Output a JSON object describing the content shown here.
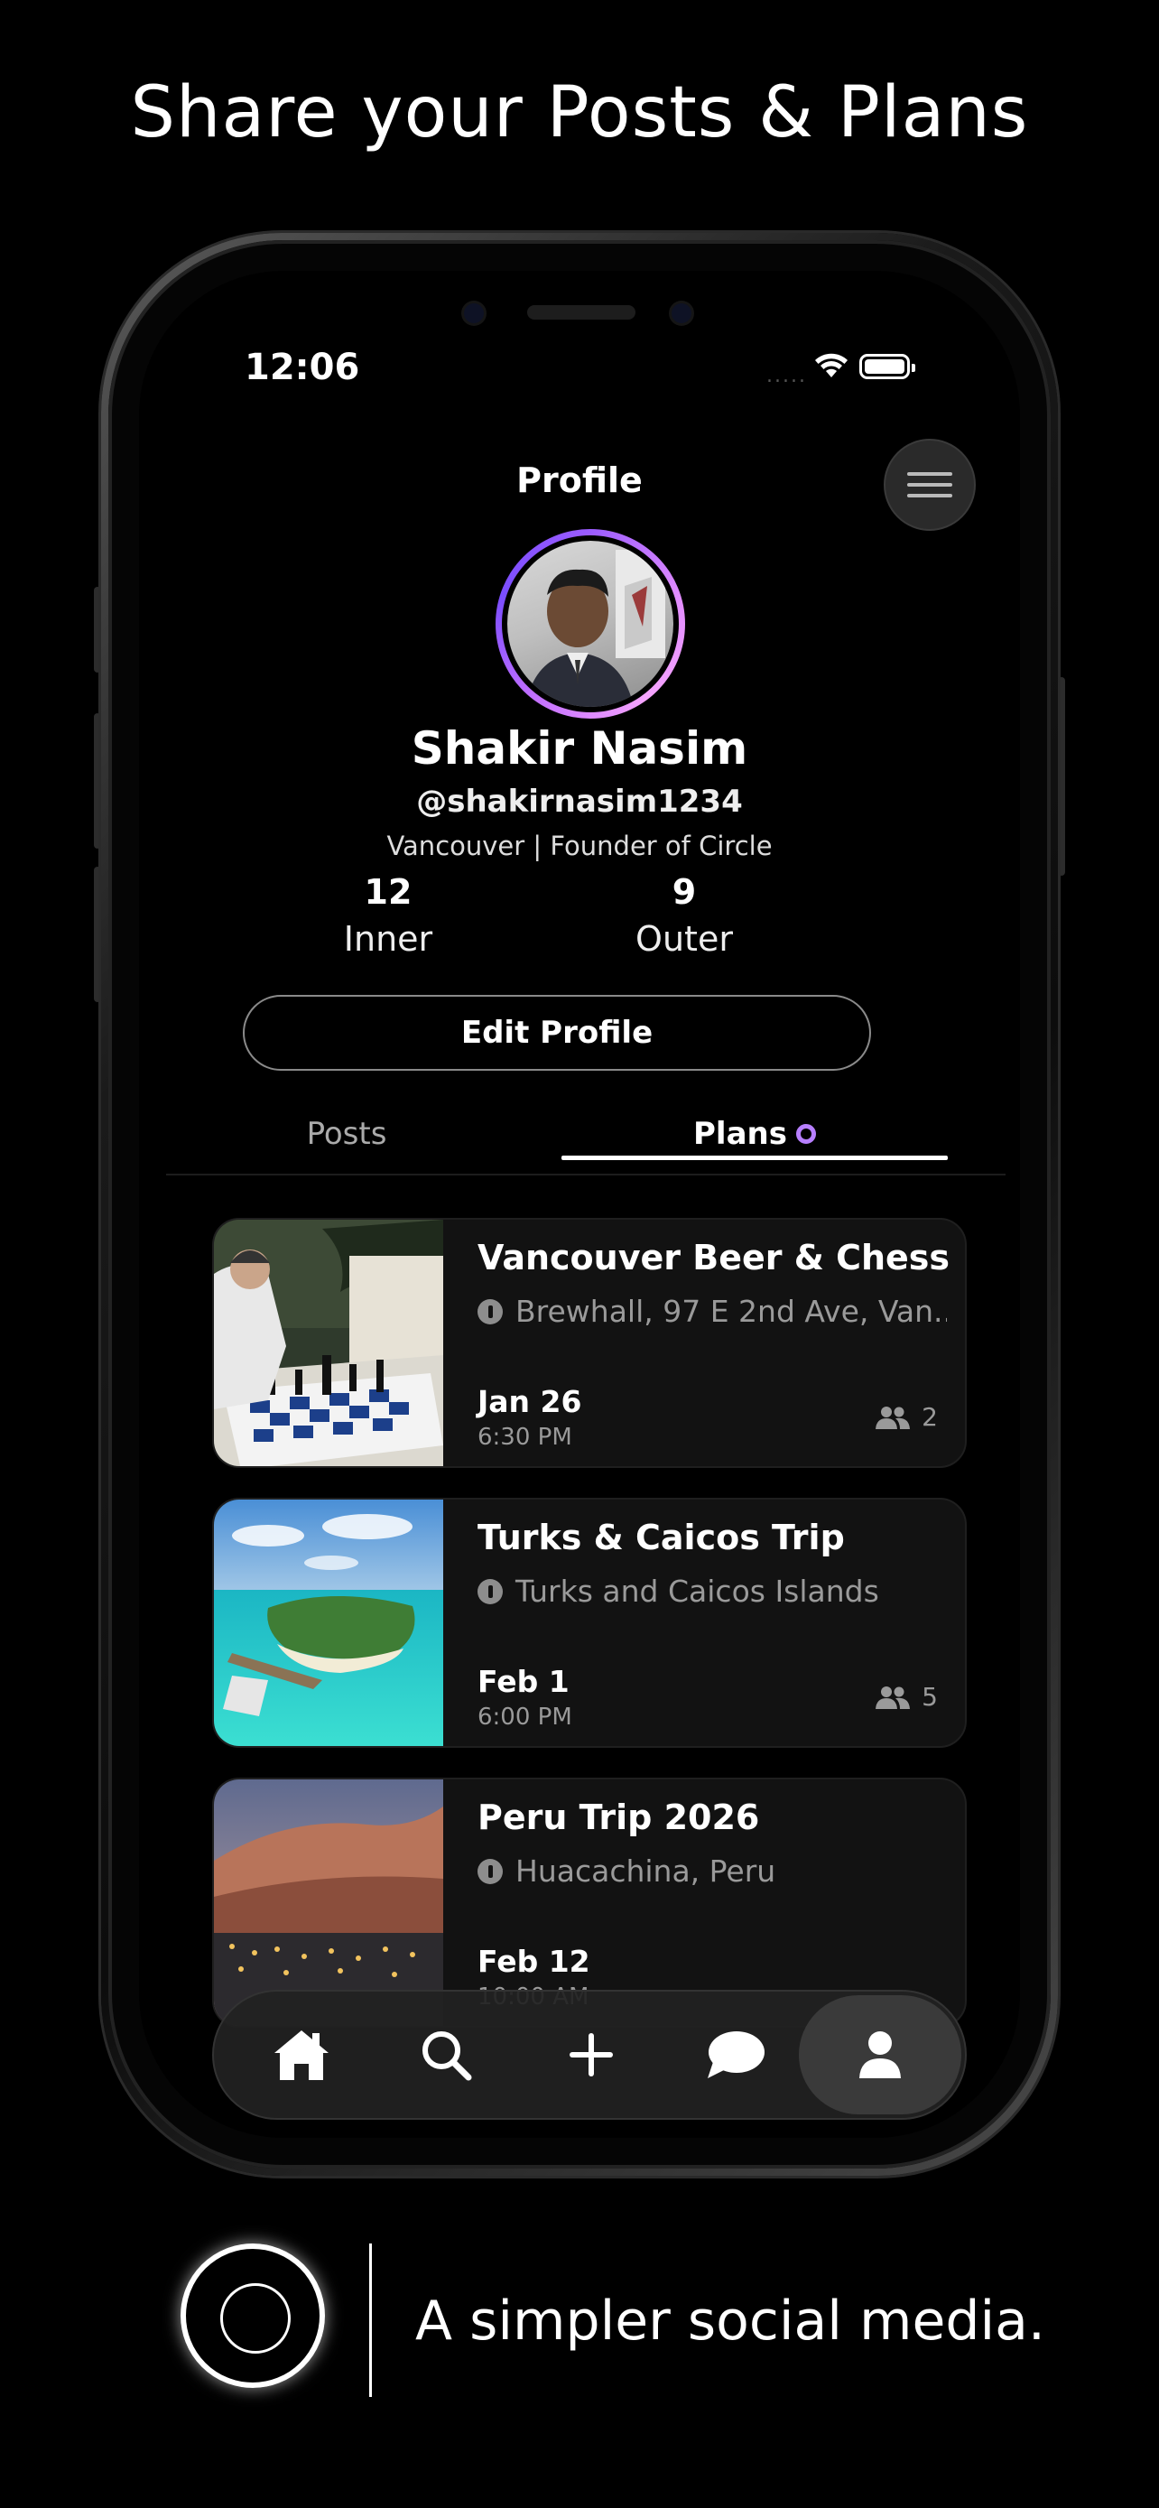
{
  "headline": "Share your Posts & Plans",
  "status": {
    "time": "12:06",
    "dots": "....."
  },
  "header": {
    "title": "Profile"
  },
  "profile": {
    "name": "Shakir Nasim",
    "handle": "@shakirnasim1234",
    "bio": "Vancouver | Founder of Circle",
    "stats": [
      {
        "value": "12",
        "label": "Inner"
      },
      {
        "value": "9",
        "label": "Outer"
      }
    ],
    "edit_label": "Edit Profile"
  },
  "tabs": [
    {
      "label": "Posts",
      "active": false
    },
    {
      "label": "Plans",
      "active": true
    }
  ],
  "plans": [
    {
      "title": "Vancouver Beer & Chess",
      "location": "Brewhall, 97 E 2nd Ave, Van...",
      "date": "Jan 26",
      "time": "6:30 PM",
      "attendees": "2"
    },
    {
      "title": "Turks & Caicos Trip",
      "location": "Turks and Caicos Islands",
      "date": "Feb 1",
      "time": "6:00 PM",
      "attendees": "5"
    },
    {
      "title": "Peru Trip 2026",
      "location": "Huacachina, Peru",
      "date": "Feb 12",
      "time": "10:00 AM",
      "attendees": ""
    }
  ],
  "tabbar": {
    "items": [
      {
        "icon": "home-icon",
        "active": false
      },
      {
        "icon": "search-icon",
        "active": false
      },
      {
        "icon": "plus-icon",
        "active": false
      },
      {
        "icon": "chat-icon",
        "active": false
      },
      {
        "icon": "person-icon",
        "active": true
      }
    ]
  },
  "tagline": "A simpler social media.",
  "colors": {
    "accent": "#b77fff",
    "background": "#000000",
    "card": "#121212"
  }
}
